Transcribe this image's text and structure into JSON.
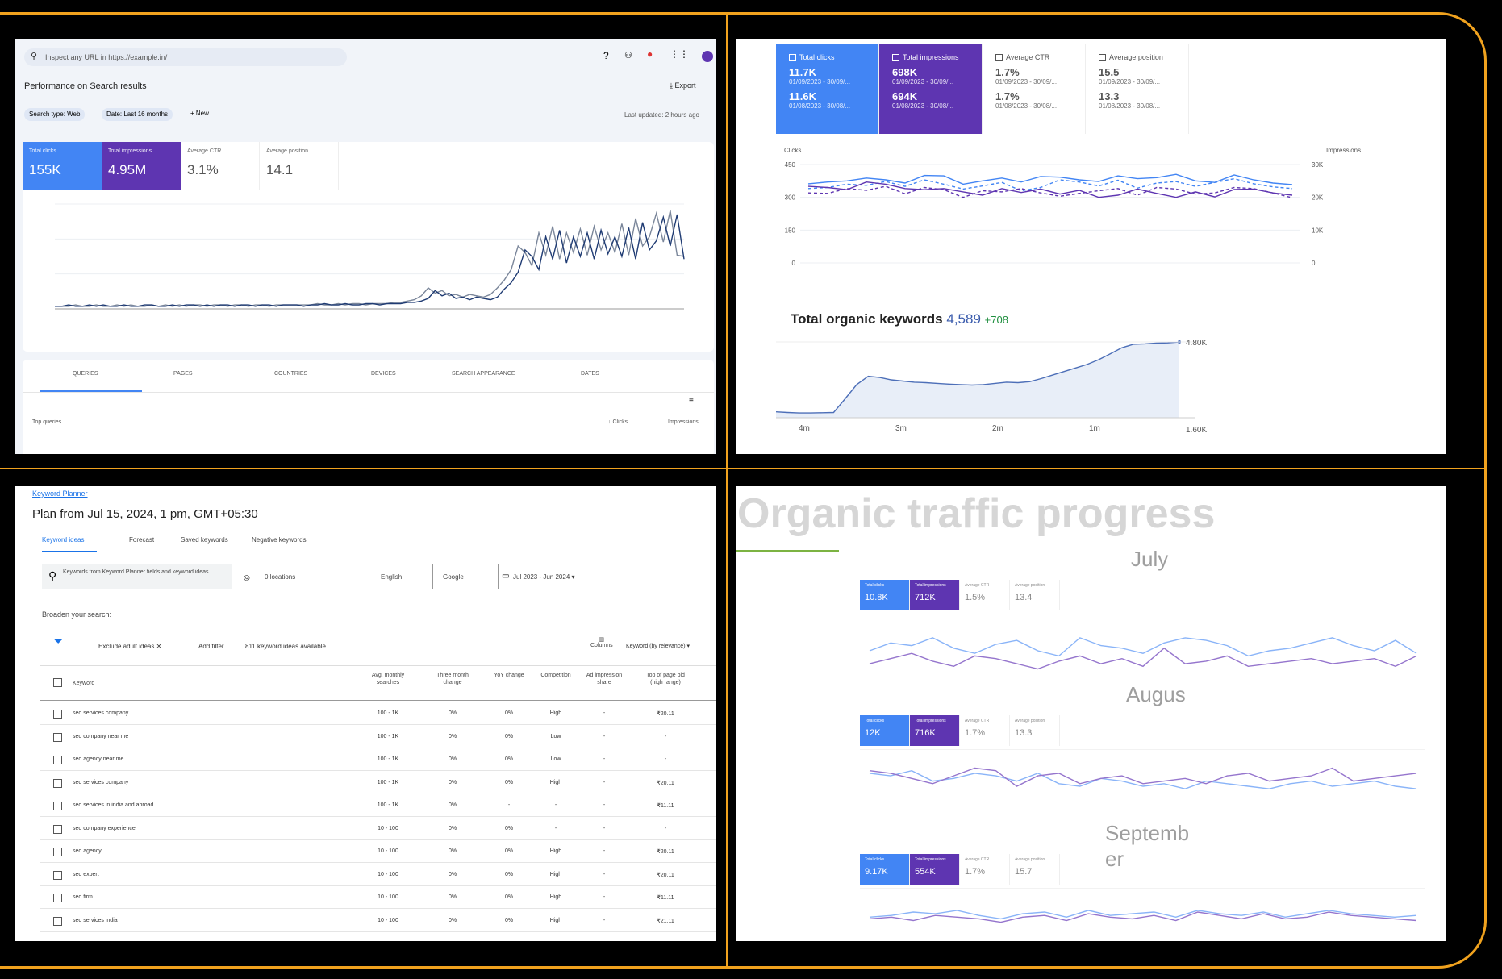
{
  "colors": {
    "frame": "#f0a21e",
    "clicks": "#4285f4",
    "impressions": "#5e35b1",
    "area_fill": "#e8eef8",
    "area_line": "#4d6fb8"
  },
  "gsc": {
    "search_placeholder": "Inspect any URL in https://example.in/",
    "title": "Performance on Search results",
    "export_label": "Export",
    "filters": [
      "Search type: Web",
      "Date: Last 16 months",
      "+ New"
    ],
    "last_updated": "Last updated: 2 hours ago",
    "metrics": [
      {
        "label": "Total clicks",
        "value": "155K"
      },
      {
        "label": "Total impressions",
        "value": "4.95M"
      },
      {
        "label": "Average CTR",
        "value": "3.1%"
      },
      {
        "label": "Average position",
        "value": "14.1"
      }
    ],
    "tabs": [
      "QUERIES",
      "PAGES",
      "COUNTRIES",
      "DEVICES",
      "SEARCH APPEARANCE",
      "DATES"
    ],
    "table_header": {
      "col": "Top queries",
      "clicks": "Clicks",
      "impressions": "Impressions"
    },
    "chart_series": {
      "clicks": [
        2,
        2,
        3,
        2,
        2,
        3,
        2,
        3,
        2,
        2,
        3,
        2,
        2,
        3,
        3,
        2,
        2,
        3,
        2,
        3,
        3,
        2,
        3,
        2,
        3,
        3,
        2,
        3,
        3,
        2,
        3,
        3,
        2,
        3,
        3,
        3,
        2,
        3,
        3,
        4,
        3,
        3,
        4,
        3,
        3,
        4,
        4,
        3,
        4,
        4,
        4,
        5,
        5,
        6,
        8,
        14,
        10,
        12,
        8,
        9,
        7,
        9,
        8,
        7,
        9,
        15,
        20,
        28,
        45,
        40,
        30,
        55,
        38,
        60,
        35,
        55,
        40,
        58,
        38,
        60,
        42,
        55,
        40,
        62,
        38,
        66,
        45,
        52,
        70,
        48,
        72,
        38
      ],
      "impressions": [
        2,
        2,
        2,
        3,
        2,
        2,
        3,
        2,
        2,
        3,
        2,
        3,
        2,
        2,
        3,
        2,
        3,
        2,
        3,
        2,
        3,
        3,
        2,
        3,
        3,
        2,
        3,
        3,
        2,
        3,
        3,
        2,
        3,
        3,
        3,
        3,
        3,
        3,
        4,
        3,
        3,
        4,
        3,
        4,
        4,
        3,
        4,
        4,
        4,
        5,
        5,
        6,
        7,
        10,
        16,
        12,
        14,
        10,
        11,
        9,
        11,
        10,
        9,
        11,
        16,
        22,
        30,
        48,
        43,
        33,
        58,
        41,
        63,
        38,
        58,
        43,
        61,
        41,
        63,
        45,
        58,
        43,
        65,
        41,
        69,
        48,
        55,
        73,
        51,
        75,
        41,
        40
      ]
    }
  },
  "gsc_compare": {
    "cards": [
      {
        "label": "Total clicks",
        "v1": "11.7K",
        "d1": "01/09/2023 - 30/09/...",
        "v2": "11.6K",
        "d2": "01/08/2023 - 30/08/..."
      },
      {
        "label": "Total impressions",
        "v1": "698K",
        "d1": "01/09/2023 - 30/09/...",
        "v2": "694K",
        "d2": "01/08/2023 - 30/08/..."
      },
      {
        "label": "Average CTR",
        "v1": "1.7%",
        "d1": "01/09/2023 - 30/09/...",
        "v2": "1.7%",
        "d2": "01/08/2023 - 30/08/..."
      },
      {
        "label": "Average position",
        "v1": "15.5",
        "d1": "01/09/2023 - 30/09/...",
        "v2": "13.3",
        "d2": "01/08/2023 - 30/08/..."
      }
    ],
    "left_axis_title": "Clicks",
    "right_axis_title": "Impressions",
    "left_ticks": [
      "450",
      "300",
      "150",
      "0"
    ],
    "right_ticks": [
      "30K",
      "20K",
      "10K",
      "0"
    ],
    "lines": {
      "clicks_a": [
        340,
        345,
        360,
        355,
        372,
        350,
        380,
        360,
        338,
        352,
        368,
        330,
        345,
        380,
        370,
        352,
        378,
        342,
        365,
        372,
        350,
        368,
        385,
        362,
        348,
        340
      ],
      "clicks_b": [
        362,
        370,
        375,
        388,
        380,
        365,
        400,
        398,
        360,
        375,
        388,
        370,
        395,
        392,
        380,
        372,
        398,
        385,
        390,
        405,
        375,
        368,
        402,
        380,
        365,
        358
      ],
      "impr_a": [
        320,
        318,
        340,
        332,
        350,
        316,
        345,
        335,
        300,
        330,
        325,
        340,
        320,
        305,
        318,
        330,
        340,
        310,
        345,
        338,
        315,
        320,
        345,
        340,
        320,
        298
      ],
      "impr_b": [
        350,
        345,
        335,
        370,
        360,
        340,
        335,
        340,
        325,
        310,
        340,
        322,
        338,
        315,
        332,
        300,
        310,
        338,
        318,
        300,
        325,
        302,
        336,
        338,
        320,
        310
      ]
    }
  },
  "keywords": {
    "title": "Total organic keywords",
    "value": "4,589",
    "delta": "+708",
    "y_top": "4.80K",
    "y_bottom": "1.60K",
    "x_labels": [
      "4m",
      "3m",
      "2m",
      "1m"
    ],
    "values": [
      1.85,
      1.82,
      1.8,
      1.8,
      1.81,
      1.82,
      2.4,
      3.0,
      3.35,
      3.3,
      3.2,
      3.15,
      3.1,
      3.08,
      3.05,
      3.02,
      3.0,
      2.98,
      3.0,
      3.05,
      3.1,
      3.08,
      3.12,
      3.25,
      3.4,
      3.55,
      3.7,
      3.85,
      4.05,
      4.3,
      4.55,
      4.7,
      4.72,
      4.75,
      4.76,
      4.8
    ]
  },
  "planner": {
    "breadcrumb": "Keyword Planner",
    "title": "Plan from Jul 15, 2024, 1 pm, GMT+05:30",
    "tabs": [
      "Keyword ideas",
      "Forecast",
      "Saved keywords",
      "Negative keywords"
    ],
    "search_text": "Keywords from Keyword Planner fields and keyword ideas",
    "location": "0 locations",
    "language": "English",
    "network": "Google",
    "date_range": "Jul 2023 - Jun 2024",
    "section_title": "Broaden your search:",
    "toolbar": {
      "exclude": "Exclude adult ideas",
      "add_filter": "Add filter",
      "count": "811 keyword ideas available",
      "columns": "Columns",
      "sort": "Keyword (by relevance)"
    },
    "columns": [
      "Keyword",
      "Avg. monthly searches",
      "Three month change",
      "YoY change",
      "Competition",
      "Ad impression share",
      "Top of page bid (high range)"
    ],
    "rows": [
      {
        "keyword": "seo services company",
        "searches": "100 - 1K",
        "three": "0%",
        "yoy": "0%",
        "comp": "High",
        "share": "-",
        "bid": "₹20.11"
      },
      {
        "keyword": "seo company near me",
        "searches": "100 - 1K",
        "three": "0%",
        "yoy": "0%",
        "comp": "Low",
        "share": "-",
        "bid": "-"
      },
      {
        "keyword": "seo agency near me",
        "searches": "100 - 1K",
        "three": "0%",
        "yoy": "0%",
        "comp": "Low",
        "share": "-",
        "bid": "-"
      },
      {
        "keyword": "seo services company",
        "searches": "100 - 1K",
        "three": "0%",
        "yoy": "0%",
        "comp": "High",
        "share": "-",
        "bid": "₹20.11"
      },
      {
        "keyword": "seo services in india and abroad",
        "searches": "100 - 1K",
        "three": "0%",
        "yoy": "-",
        "comp": "-",
        "share": "-",
        "bid": "₹11.11"
      },
      {
        "keyword": "seo company experience",
        "searches": "10 - 100",
        "three": "0%",
        "yoy": "0%",
        "comp": "-",
        "share": "-",
        "bid": "-"
      },
      {
        "keyword": "seo agency",
        "searches": "10 - 100",
        "three": "0%",
        "yoy": "0%",
        "comp": "High",
        "share": "-",
        "bid": "₹20.11"
      },
      {
        "keyword": "seo expert",
        "searches": "10 - 100",
        "three": "0%",
        "yoy": "0%",
        "comp": "High",
        "share": "-",
        "bid": "₹20.11"
      },
      {
        "keyword": "seo firm",
        "searches": "10 - 100",
        "three": "0%",
        "yoy": "0%",
        "comp": "High",
        "share": "-",
        "bid": "₹11.11"
      },
      {
        "keyword": "seo services india",
        "searches": "10 - 100",
        "three": "0%",
        "yoy": "0%",
        "comp": "High",
        "share": "-",
        "bid": "₹21.11"
      }
    ]
  },
  "progress": {
    "heading": "Organic traffic progress",
    "months": [
      {
        "name": "July",
        "clicks": "10.8K",
        "impressions": "712K",
        "ctr": "1.5%",
        "position": "13.4",
        "a": [
          20,
          26,
          24,
          30,
          22,
          18,
          25,
          28,
          20,
          16,
          30,
          24,
          22,
          18,
          26,
          30,
          28,
          24,
          16,
          20,
          22,
          26,
          30,
          24,
          20,
          28,
          18
        ],
        "b": [
          10,
          14,
          18,
          12,
          8,
          16,
          14,
          10,
          6,
          12,
          16,
          10,
          14,
          8,
          22,
          10,
          12,
          16,
          8,
          10,
          12,
          14,
          10,
          12,
          14,
          8,
          16
        ]
      },
      {
        "name": "Augus",
        "clicks": "12K",
        "impressions": "716K",
        "ctr": "1.7%",
        "position": "13.3",
        "a": [
          30,
          28,
          32,
          24,
          26,
          30,
          28,
          24,
          30,
          22,
          20,
          26,
          24,
          20,
          22,
          18,
          24,
          22,
          20,
          18,
          22,
          24,
          20,
          22,
          24,
          20,
          18
        ],
        "b": [
          32,
          30,
          26,
          22,
          28,
          34,
          32,
          20,
          28,
          30,
          22,
          26,
          28,
          22,
          24,
          26,
          22,
          28,
          30,
          24,
          26,
          28,
          34,
          24,
          26,
          28,
          30
        ]
      },
      {
        "name": "Septemb er",
        "clicks": "9.17K",
        "impressions": "554K",
        "ctr": "1.7%",
        "position": "15.7",
        "a": [
          14,
          16,
          20,
          18,
          22,
          16,
          12,
          18,
          20,
          14,
          22,
          16,
          18,
          20,
          14,
          22,
          18,
          16,
          20,
          14,
          18,
          22,
          18,
          16,
          14,
          16
        ],
        "b": [
          12,
          14,
          10,
          16,
          14,
          12,
          8,
          14,
          16,
          10,
          18,
          14,
          12,
          16,
          10,
          20,
          16,
          12,
          18,
          12,
          14,
          20,
          16,
          14,
          12,
          10
        ]
      }
    ],
    "card_labels": {
      "clicks": "Total clicks",
      "impressions": "Total impressions",
      "ctr": "Average CTR",
      "position": "Average position"
    }
  }
}
